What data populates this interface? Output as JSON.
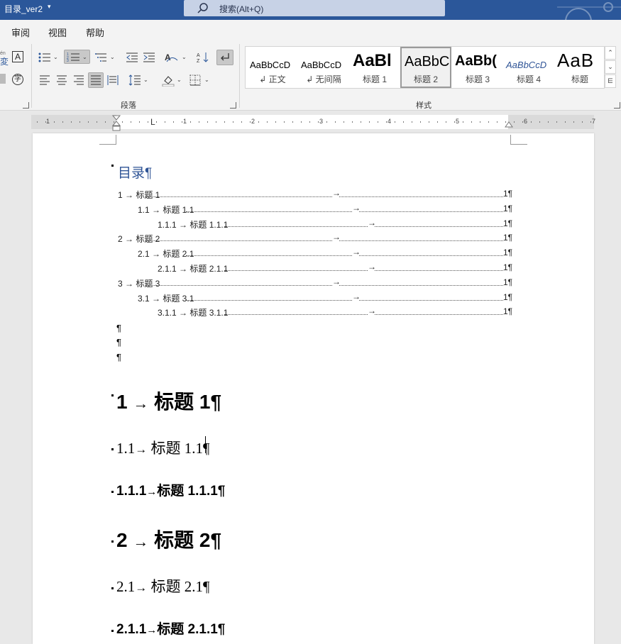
{
  "titlebar": {
    "doc_title": "目录_ver2",
    "doc_caret": "▾",
    "search_placeholder": "搜索(Alt+Q)",
    "search_icon": "search-icon"
  },
  "menu": [
    "审阅",
    "视图",
    "帮助"
  ],
  "ribbon": {
    "left_glyph_a": "én",
    "left_glyph_b": "変",
    "left_glyph_c": "A",
    "paragraph_label": "段落",
    "styles_label": "样式",
    "styles": [
      {
        "sample": "AaBbCcD",
        "name": "↲ 正文"
      },
      {
        "sample": "AaBbCcD",
        "name": "↲ 无间隔"
      },
      {
        "sample": "AaBl",
        "name": "标题 1"
      },
      {
        "sample": "AaBbC",
        "name": "标题 2"
      },
      {
        "sample": "AaBb(",
        "name": "标题 3"
      },
      {
        "sample": "AaBbCcD",
        "name": "标题 4"
      },
      {
        "sample": "AaB",
        "name": "标题"
      }
    ],
    "scroll_up": "⌃",
    "scroll_down": "⌄",
    "scroll_more": "⋿"
  },
  "ruler": {
    "numbers": [
      "1",
      "1",
      "2",
      "3",
      "4",
      "5",
      "6",
      "7"
    ],
    "tab_marker": "L"
  },
  "document": {
    "toc_title": "目录¶",
    "toc": [
      {
        "num": "1",
        "text": "标题 1",
        "page": "1¶"
      },
      {
        "num": "1.1",
        "text": "标题 1.1",
        "page": "1¶"
      },
      {
        "num": "1.1.1",
        "text": "标题 1.1.1",
        "page": "1¶"
      },
      {
        "num": "2",
        "text": "标题 2",
        "page": "1¶"
      },
      {
        "num": "2.1",
        "text": "标题 2.1",
        "page": "1¶"
      },
      {
        "num": "2.1.1",
        "text": "标题 2.1.1",
        "page": "1¶"
      },
      {
        "num": "3",
        "text": "标题 3",
        "page": "1¶"
      },
      {
        "num": "3.1",
        "text": "标题 3.1",
        "page": "1¶"
      },
      {
        "num": "3.1.1",
        "text": "标题 3.1.1",
        "page": "1¶"
      }
    ],
    "tab_arrow": "→",
    "empty_paragraphs": [
      "¶",
      "¶",
      "¶"
    ],
    "headings": [
      {
        "num": "1",
        "text": "标题 1¶"
      },
      {
        "num": "1.1",
        "text": "标题 1.1¶"
      },
      {
        "num": "1.1.1",
        "text": "标题 1.1.1¶"
      },
      {
        "num": "2",
        "text": "标题 2¶"
      },
      {
        "num": "2.1",
        "text": "标题 2.1¶"
      },
      {
        "num": "2.1.1",
        "text": "标题 2.1.1¶"
      }
    ]
  }
}
